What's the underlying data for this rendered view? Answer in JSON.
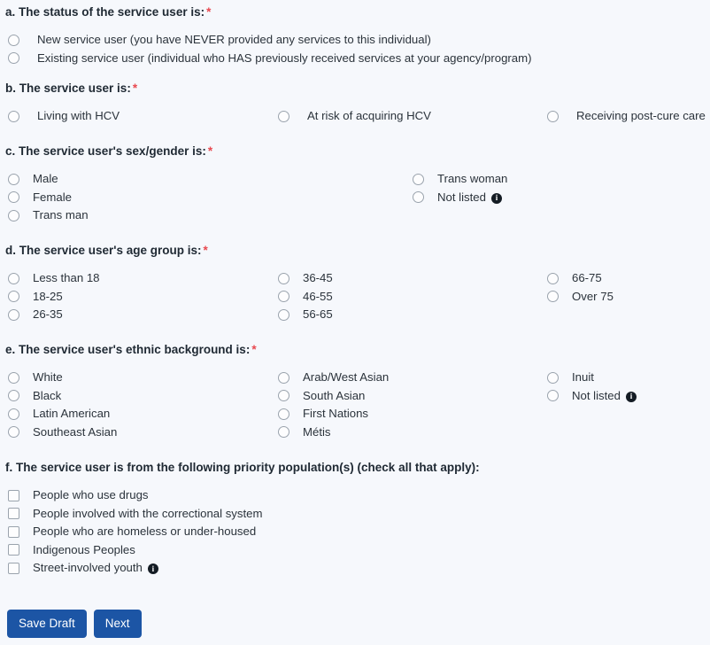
{
  "required_marker": "*",
  "colors": {
    "background": "#f6f8fc",
    "button": "#1c55a5",
    "required_asterisk": "#e8484f",
    "heading_text": "#1f2933",
    "label_text": "#2b333b",
    "control_border": "#9aa3ad",
    "info_icon": "#141c24"
  },
  "sections": {
    "a": {
      "heading": "a. The status of the service user is:",
      "required": true,
      "options": [
        {
          "label": "New service user (you have NEVER provided any services to this individual)"
        },
        {
          "label": "Existing service user (individual who HAS previously received services at your agency/program)"
        }
      ]
    },
    "b": {
      "heading": "b. The service user is:",
      "required": true,
      "columns": [
        [
          {
            "label": "Living with HCV"
          }
        ],
        [
          {
            "label": "At risk of acquiring HCV"
          }
        ],
        [
          {
            "label": "Receiving post-cure care"
          }
        ]
      ]
    },
    "c": {
      "heading": "c. The service user's sex/gender is:",
      "required": true,
      "columns": [
        [
          {
            "label": "Male"
          },
          {
            "label": "Female"
          },
          {
            "label": "Trans man"
          }
        ],
        [
          {
            "label": "Trans woman"
          },
          {
            "label": "Not listed",
            "info": true
          }
        ]
      ]
    },
    "d": {
      "heading": "d. The service user's age group is:",
      "required": true,
      "columns": [
        [
          {
            "label": "Less than 18"
          },
          {
            "label": "18-25"
          },
          {
            "label": "26-35"
          }
        ],
        [
          {
            "label": "36-45"
          },
          {
            "label": "46-55"
          },
          {
            "label": "56-65"
          }
        ],
        [
          {
            "label": "66-75"
          },
          {
            "label": "Over 75"
          }
        ]
      ]
    },
    "e": {
      "heading": "e. The service user's ethnic background is:",
      "required": true,
      "columns": [
        [
          {
            "label": "White"
          },
          {
            "label": "Black"
          },
          {
            "label": "Latin American"
          },
          {
            "label": "Southeast Asian"
          }
        ],
        [
          {
            "label": "Arab/West Asian"
          },
          {
            "label": "South Asian"
          },
          {
            "label": "First Nations"
          },
          {
            "label": "Métis"
          }
        ],
        [
          {
            "label": "Inuit"
          },
          {
            "label": "Not listed",
            "info": true
          }
        ]
      ]
    },
    "f": {
      "heading": "f. The service user is from the following priority population(s) (check all that apply):",
      "required": false,
      "options": [
        {
          "label": "People who use drugs"
        },
        {
          "label": "People involved with the correctional system"
        },
        {
          "label": "People who are homeless or under-housed"
        },
        {
          "label": "Indigenous Peoples"
        },
        {
          "label": "Street-involved youth",
          "info": true
        }
      ]
    }
  },
  "footer": {
    "save_draft_label": "Save Draft",
    "next_label": "Next"
  },
  "info_glyph": "i"
}
